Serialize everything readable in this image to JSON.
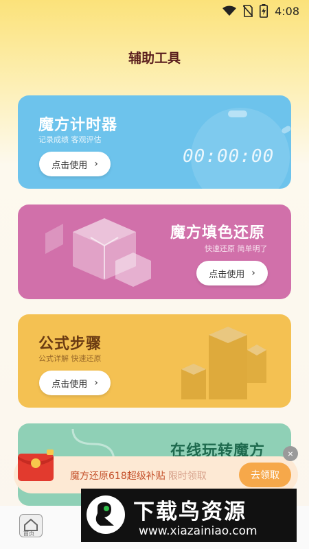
{
  "status": {
    "time": "4:08",
    "icons": [
      "wifi-icon",
      "no-sim-icon",
      "battery-charging-icon"
    ]
  },
  "header": {
    "title": "辅助工具"
  },
  "cards": [
    {
      "title": "魔方计时器",
      "subtitle": "记录成绩 客观评估",
      "button": "点击使用",
      "display": "00:00:00",
      "color": "#6dc3ec"
    },
    {
      "title": "魔方填色还原",
      "subtitle": "快速还原 简单明了",
      "button": "点击使用",
      "color": "#d170aa"
    },
    {
      "title": "公式步骤",
      "subtitle": "公式详解 快速还原",
      "button": "点击使用",
      "color": "#f4c152"
    },
    {
      "title": "在线玩转魔方",
      "color": "#8fd0b6"
    }
  ],
  "promo": {
    "text": "魔方还原618超级补贴",
    "limited": "限时领取",
    "button": "去领取",
    "close": "×"
  },
  "bottom_nav": {
    "home_label": "首页"
  },
  "watermark": {
    "title": "下载鸟资源",
    "url": "www.xiazainiao.com"
  }
}
